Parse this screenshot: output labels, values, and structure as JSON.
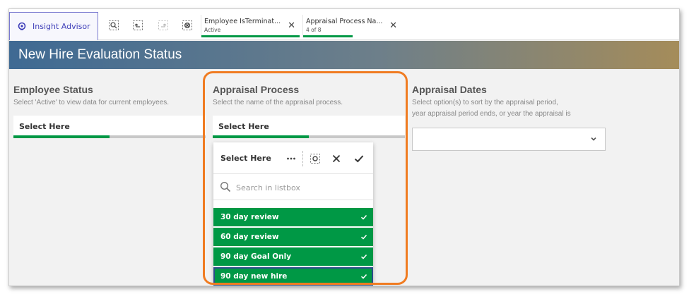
{
  "toolbar": {
    "insight_advisor_label": "Insight Advisor",
    "selections": [
      {
        "title": "Employee IsTerminat...",
        "subtitle": "Active",
        "fill": 1.0
      },
      {
        "title": "Appraisal Process Na...",
        "subtitle": "4 of 8",
        "fill": 0.5
      }
    ]
  },
  "header": {
    "title": "New Hire Evaluation Status"
  },
  "filters": [
    {
      "title": "Employee Status",
      "description": "Select 'Active' to view data for current employees.",
      "value_label": "Select Here",
      "fill": 0.5
    },
    {
      "title": "Appraisal Process",
      "description": "Select the name of the appraisal process.",
      "value_label": "Select Here",
      "fill": 0.5
    },
    {
      "title": "Appraisal Dates",
      "description_line1": "Select option(s) to sort by the appraisal period,",
      "description_line2": "year appraisal period ends, or year the appraisal is"
    }
  ],
  "listbox": {
    "title": "Select Here",
    "search_placeholder": "Search in listbox",
    "items": [
      {
        "label": "30 day review",
        "selected": true
      },
      {
        "label": "60 day review",
        "selected": true
      },
      {
        "label": "90 day Goal Only",
        "selected": true
      },
      {
        "label": "90 day new hire",
        "selected": true
      }
    ]
  },
  "colors": {
    "selected_green": "#009845",
    "highlight_orange": "#f07c22",
    "insight_purple": "#3d3db8"
  }
}
